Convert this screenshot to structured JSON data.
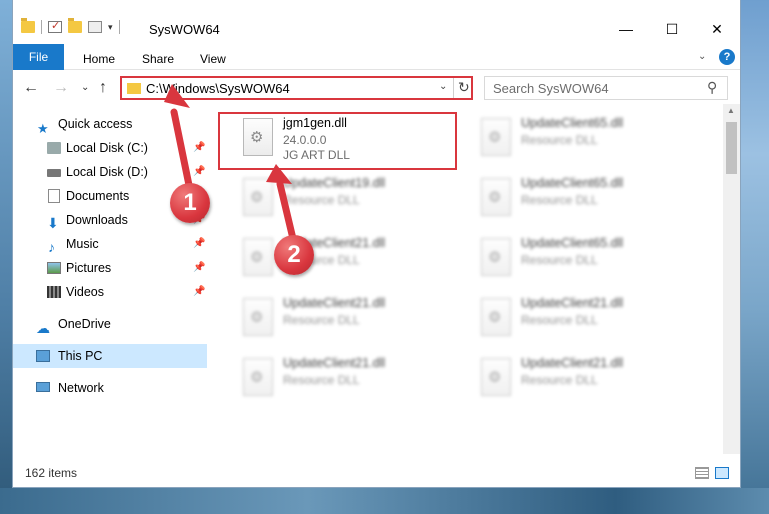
{
  "window": {
    "title": "SysWOW64",
    "controls": {
      "minimize": "—",
      "maximize": "☐",
      "close": "✕"
    }
  },
  "ribbon": {
    "tabs": [
      "File",
      "Home",
      "Share",
      "View"
    ],
    "help": "?"
  },
  "address": {
    "path": "C:\\Windows\\SysWOW64",
    "search_placeholder": "Search SysWOW64"
  },
  "sidebar": {
    "quick_access": "Quick access",
    "items": [
      {
        "label": "Local Disk (C:)",
        "icon": "drive-icon",
        "pinned": true
      },
      {
        "label": "Local Disk (D:)",
        "icon": "drive-icon",
        "pinned": true
      },
      {
        "label": "Documents",
        "icon": "documents-icon",
        "pinned": true
      },
      {
        "label": "Downloads",
        "icon": "downloads-icon",
        "pinned": true
      },
      {
        "label": "Music",
        "icon": "music-icon",
        "pinned": true
      },
      {
        "label": "Pictures",
        "icon": "pictures-icon",
        "pinned": true
      },
      {
        "label": "Videos",
        "icon": "videos-icon",
        "pinned": true
      }
    ],
    "onedrive": "OneDrive",
    "this_pc": "This PC",
    "network": "Network"
  },
  "files": [
    {
      "name": "jgm1gen.dll",
      "version": "24.0.0.0",
      "desc": "JG ART DLL"
    },
    {
      "name": "UpdateClient65.dll",
      "desc": "Resource DLL"
    },
    {
      "name": "UpdateClient19.dll",
      "desc": "Resource DLL"
    },
    {
      "name": "UpdateClient65.dll",
      "desc": "Resource DLL"
    },
    {
      "name": "UpdateClient21.dll",
      "desc": "Resource DLL"
    },
    {
      "name": "UpdateClient65.dll",
      "desc": "Resource DLL"
    },
    {
      "name": "UpdateClient21.dll",
      "desc": "Resource DLL"
    },
    {
      "name": "UpdateClient21.dll",
      "desc": "Resource DLL"
    },
    {
      "name": "UpdateClient21.dll",
      "desc": "Resource DLL"
    },
    {
      "name": "UpdateClient21.dll",
      "desc": "Resource DLL"
    }
  ],
  "status": {
    "item_count": "162 items"
  },
  "callouts": [
    "1",
    "2"
  ],
  "colors": {
    "accent": "#1979ca",
    "highlight": "#d9363e",
    "selection": "#cce8ff"
  }
}
